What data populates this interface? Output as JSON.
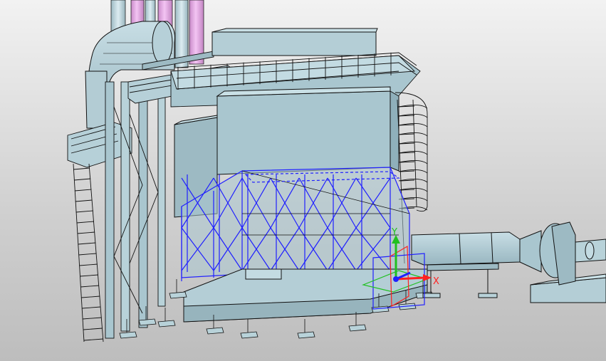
{
  "viewport": {
    "type": "3d-cad-model-view",
    "background_colors": [
      "#f2f2f2",
      "#cfcfcf",
      "#bdbdbd"
    ]
  },
  "model": {
    "body_color": "#a9c6cf",
    "body_shade": "#8fb0bb",
    "body_light": "#c3dbe2",
    "edge_color": "#111111",
    "pipe_color": "#e6a5e6",
    "selection_color": "#2020ff"
  },
  "triad": {
    "x_label": "X",
    "y_label": "Y",
    "x_color": "#ff2020",
    "y_color": "#20c020",
    "z_color": "#2020ff"
  }
}
